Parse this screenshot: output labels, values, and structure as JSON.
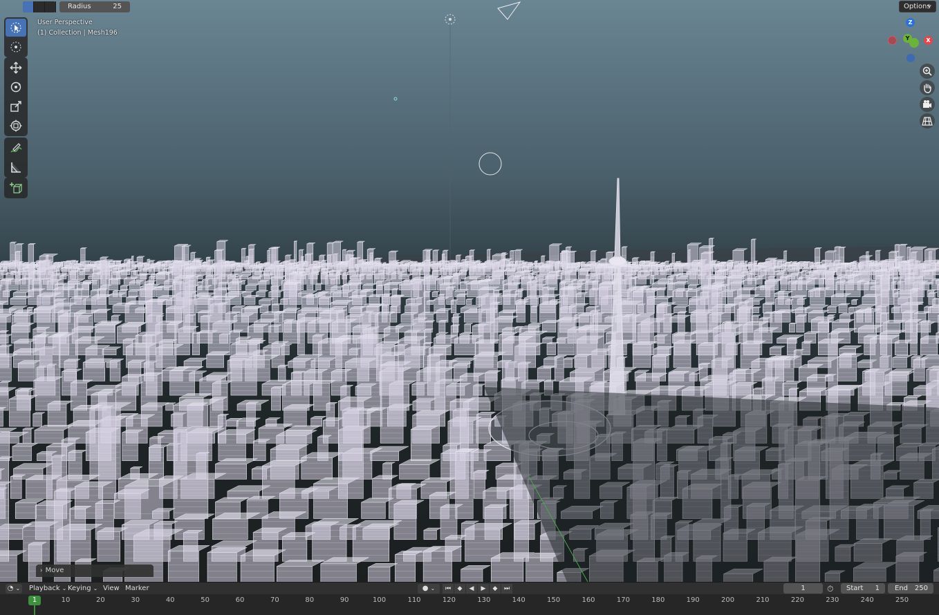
{
  "header": {
    "radius_label": "Radius",
    "radius_value": "25",
    "options_label": "Options"
  },
  "viewport": {
    "view_name": "User Perspective",
    "collection_info": "(1) Collection | Mesh196",
    "operator_panel": "Move"
  },
  "tools": [
    "select-box",
    "cursor",
    "move",
    "rotate",
    "scale",
    "transform",
    "annotate",
    "measure",
    "add-cube"
  ],
  "gizmo": {
    "z": "Z",
    "y": "Y",
    "x": "X"
  },
  "timeline": {
    "menus": [
      "Playback",
      "Keying",
      "View",
      "Marker"
    ],
    "current_frame": "1",
    "start_label": "Start",
    "start_value": "1",
    "end_label": "End",
    "end_value": "250",
    "ruler_current": "1",
    "ruler_ticks": [
      "10",
      "20",
      "30",
      "40",
      "50",
      "60",
      "70",
      "80",
      "90",
      "100",
      "110",
      "120",
      "130",
      "140",
      "150",
      "160",
      "170",
      "180",
      "190",
      "200",
      "210",
      "220",
      "230",
      "240",
      "250"
    ]
  },
  "colors": {
    "accent": "#4772b3",
    "frame_green": "#3e8f3e",
    "wire": "#e6e4f0"
  }
}
